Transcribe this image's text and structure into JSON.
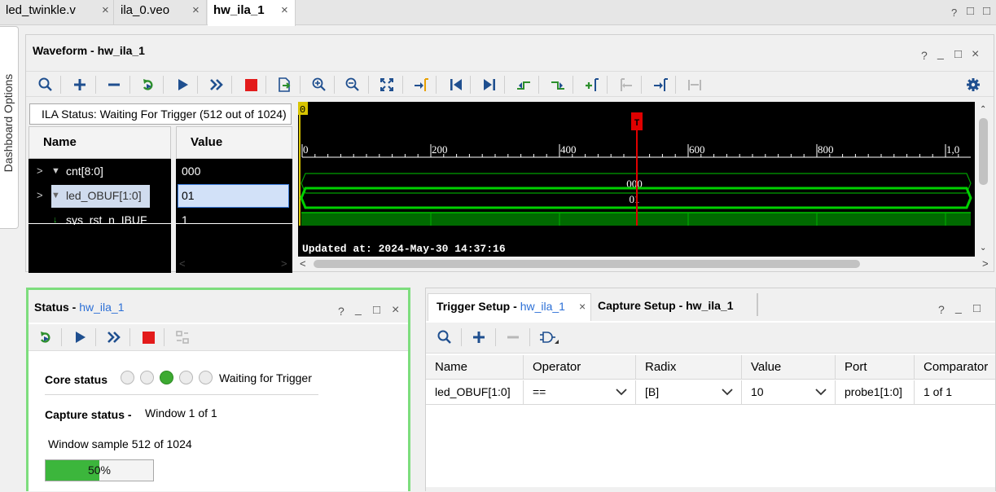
{
  "editor_tabs": [
    {
      "label": "led_twinkle.v",
      "active": false
    },
    {
      "label": "ila_0.veo",
      "active": false
    },
    {
      "label": "hw_ila_1",
      "active": true
    }
  ],
  "close_glyph": "×",
  "window_controls": {
    "help": "?",
    "minimize": "_",
    "restore": "□",
    "close": "×"
  },
  "side_panel": {
    "label": "Dashboard Options"
  },
  "waveform": {
    "title": "Waveform - hw_ila_1",
    "ila_status": "ILA Status:  Waiting For Trigger (512 out of 1024)",
    "name_header": "Name",
    "value_header": "Value",
    "signals": [
      {
        "name": "cnt[8:0]",
        "value": "000",
        "expandable": true,
        "icon": "bus-icon"
      },
      {
        "name": "led_OBUF[1:0]",
        "value": "01",
        "expandable": true,
        "icon": "bus-icon",
        "selected": true
      },
      {
        "name": "sys_rst_n_IBUF",
        "value": "1",
        "expandable": false,
        "icon": "wire-icon"
      }
    ],
    "wave_labels": [
      "000",
      "01"
    ],
    "ruler_start_marker": "0",
    "ruler_ticks": [
      "0",
      "200",
      "400",
      "600",
      "800",
      "1,0"
    ],
    "trigger_marker": "T",
    "trigger_sample": 512,
    "updated_at": "Updated at: 2024-May-30 14:37:16",
    "toolbar_icons": [
      "search-icon",
      "add-icon",
      "remove-icon",
      "run-trigger-immediate-icon",
      "run-trigger-icon",
      "auto-rerun-icon",
      "stop-icon",
      "export-icon",
      "zoom-in-icon",
      "zoom-out-icon",
      "zoom-fit-icon",
      "go-to-cursor-icon",
      "go-to-start-icon",
      "go-to-end-icon",
      "previous-transition-icon",
      "next-transition-icon",
      "add-marker-icon",
      "previous-marker-icon",
      "next-marker-icon",
      "swap-markers-icon",
      "settings-icon"
    ],
    "colors": {
      "wave": "#00d000",
      "trigger": "#e00000",
      "background": "#000000"
    }
  },
  "status_panel": {
    "title_prefix": "Status - ",
    "title_link": "hw_ila_1",
    "core_status_label": "Core status",
    "core_status_active_index": 2,
    "core_status_text": "Waiting for Trigger",
    "capture_status_label": "Capture status -",
    "capture_status_value": "Window 1 of 1",
    "window_sample": "Window sample 512 of 1024",
    "progress": {
      "percent": 50,
      "label": "50%"
    }
  },
  "trigger_panel": {
    "tab_trigger_prefix": "Trigger Setup - ",
    "tab_trigger_link": "hw_ila_1",
    "tab_capture": "Capture Setup - hw_ila_1",
    "columns": [
      "Name",
      "Operator",
      "Radix",
      "Value",
      "Port",
      "Comparator"
    ],
    "rows": [
      {
        "name": "led_OBUF[1:0]",
        "operator": "==",
        "radix": "[B]",
        "value": "10",
        "port": "probe1[1:0]",
        "comparator": "1 of 1"
      }
    ]
  }
}
